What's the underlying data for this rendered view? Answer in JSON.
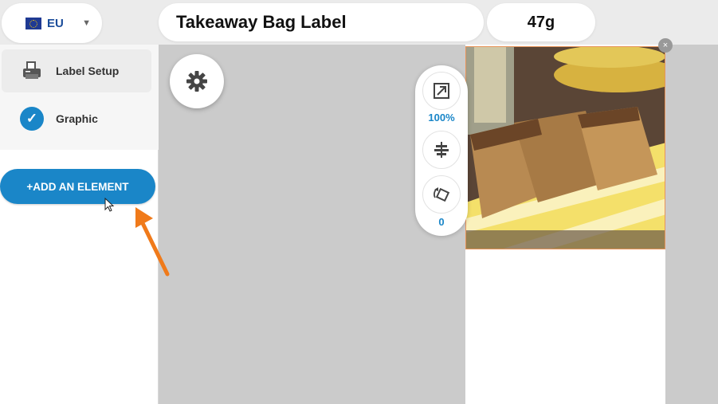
{
  "header": {
    "region": {
      "code": "EU",
      "flag_icon": "eu-flag-icon"
    },
    "title": "Takeaway Bag Label",
    "weight": "47g"
  },
  "sidebar": {
    "items": [
      {
        "label": "Label Setup",
        "icon": "printer-icon",
        "active": true
      },
      {
        "label": "Graphic",
        "icon": "check-icon",
        "active": false
      }
    ],
    "add_button_label": "+ADD AN ELEMENT"
  },
  "toolbar": {
    "scale_value": "100%",
    "rotation_value": "0"
  },
  "colors": {
    "accent": "#1a86c8",
    "arrow": "#f07a1a",
    "selection_border": "#e8945a"
  }
}
